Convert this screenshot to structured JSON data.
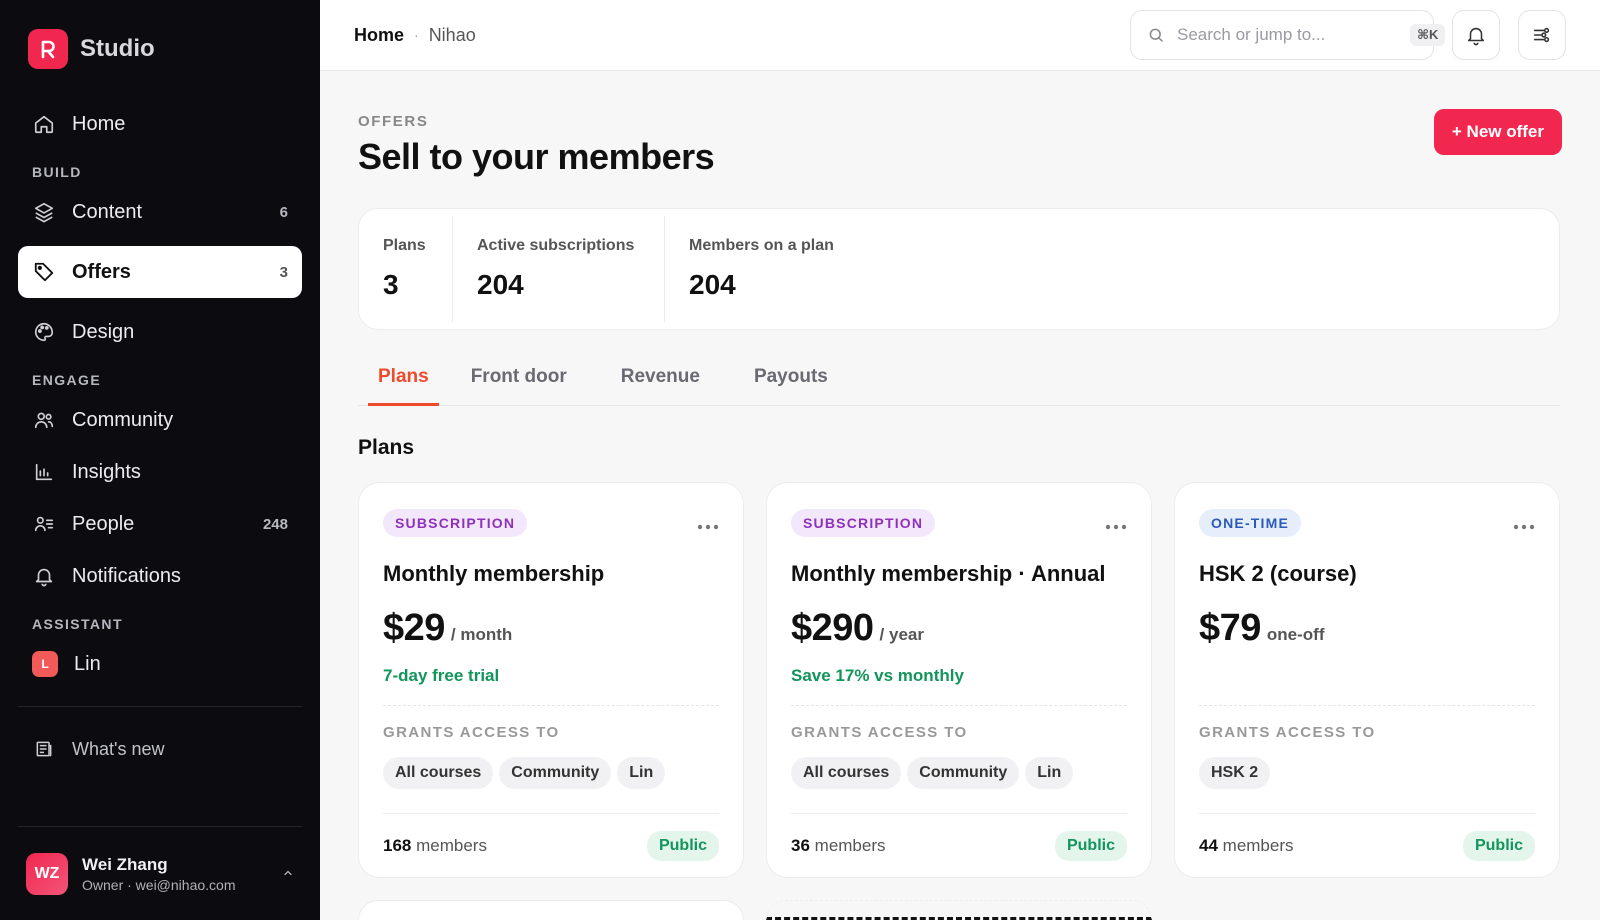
{
  "brand": {
    "name": "Studio",
    "accent": "#f2274f"
  },
  "nav": {
    "home": {
      "label": "Home"
    },
    "sections": {
      "build": "BUILD",
      "engage": "ENGAGE",
      "assistant": "ASSISTANT"
    },
    "content": {
      "label": "Content",
      "count": "6"
    },
    "offers": {
      "label": "Offers",
      "count": "3"
    },
    "design": {
      "label": "Design"
    },
    "community": {
      "label": "Community"
    },
    "insights": {
      "label": "Insights"
    },
    "people": {
      "label": "People",
      "count": "248"
    },
    "notifications": {
      "label": "Notifications"
    },
    "lin": {
      "label": "Lin",
      "avatar": "L"
    },
    "whats_new": {
      "label": "What's new"
    }
  },
  "user": {
    "initials": "WZ",
    "name": "Wei Zhang",
    "sub": "Owner · wei@nihao.com"
  },
  "topbar": {
    "crumb_home": "Home",
    "crumb_sep": "·",
    "crumb_sub": "Nihao",
    "search_placeholder": "Search or jump to...",
    "shortcut": "⌘K"
  },
  "page": {
    "eyebrow": "OFFERS",
    "title": "Sell to your members",
    "new_button": "+ New offer"
  },
  "stats": [
    {
      "label": "Plans",
      "value": "3"
    },
    {
      "label": "Active subscriptions",
      "value": "204"
    },
    {
      "label": "Members on a plan",
      "value": "204"
    }
  ],
  "tabs": [
    "Plans",
    "Front door",
    "Revenue",
    "Payouts"
  ],
  "section_title": "Plans",
  "cards": [
    {
      "type": "SUBSCRIPTION",
      "name": "Monthly membership",
      "price": "$29",
      "period": "/ month",
      "note": "7-day free trial",
      "grants_label": "GRANTS ACCESS TO",
      "chips": [
        "All courses",
        "Community",
        "Lin"
      ],
      "members_count": "168",
      "members_label": "members",
      "visibility": "Public"
    },
    {
      "type": "SUBSCRIPTION",
      "name": "Monthly membership · Annual",
      "price": "$290",
      "period": "/ year",
      "note": "Save 17% vs monthly",
      "grants_label": "GRANTS ACCESS TO",
      "chips": [
        "All courses",
        "Community",
        "Lin"
      ],
      "members_count": "36",
      "members_label": "members",
      "visibility": "Public"
    },
    {
      "type": "ONE-TIME",
      "name": "HSK 2 (course)",
      "price": "$79",
      "period": "one-off",
      "note": "",
      "grants_label": "GRANTS ACCESS TO",
      "chips": [
        "HSK 2"
      ],
      "members_count": "44",
      "members_label": "members",
      "visibility": "Public"
    }
  ],
  "icons": {
    "home": "home-icon",
    "content": "layers-icon",
    "offers": "tag-icon",
    "design": "palette-icon",
    "community": "users-icon",
    "insights": "bar-chart-icon",
    "people": "user-list-icon",
    "notifications": "bell-icon",
    "whats_new": "newspaper-icon",
    "search": "search-icon",
    "settings": "sliders-icon",
    "more": "more-horizontal-icon"
  }
}
